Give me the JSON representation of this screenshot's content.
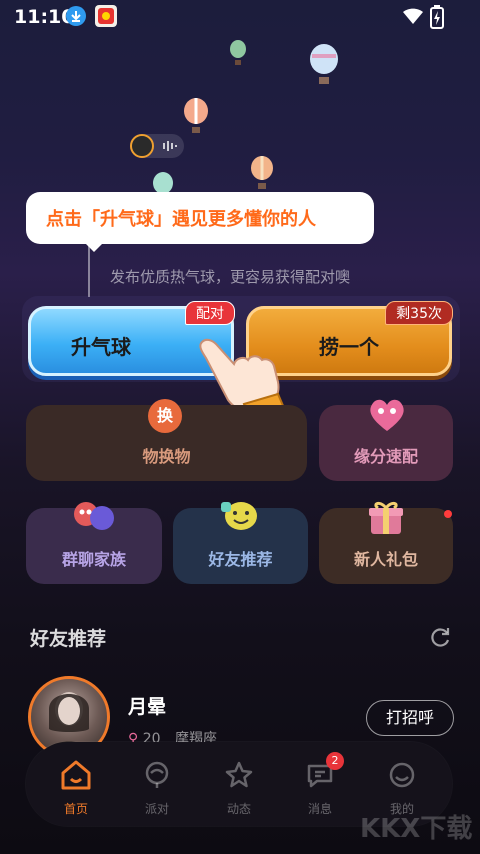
{
  "status_bar": {
    "time": "11:10"
  },
  "tip": {
    "text": "点击「升气球」遇见更多懂你的人"
  },
  "hint": {
    "text": "发布优质热气球，更容易获得配对噢"
  },
  "actions": {
    "raise_balloon": {
      "label": "升气球",
      "badge": "配对"
    },
    "fish_one": {
      "label": "捞一个",
      "badge": "剩35次"
    }
  },
  "features": {
    "exchange": {
      "label": "物换物",
      "icon_text": "换"
    },
    "match": {
      "label": "缘分速配"
    },
    "group": {
      "label": "群聊家族"
    },
    "friend": {
      "label": "好友推荐"
    },
    "gift": {
      "label": "新人礼包"
    }
  },
  "friends_section": {
    "title": "好友推荐"
  },
  "friend": {
    "name": "月晕",
    "age": "20",
    "zodiac": "摩羯座",
    "greet_label": "打招呼"
  },
  "tabs": [
    {
      "label": "首页"
    },
    {
      "label": "派对"
    },
    {
      "label": "动态"
    },
    {
      "label": "消息",
      "badge": "2"
    },
    {
      "label": "我的"
    }
  ],
  "watermark": "KKX下载",
  "colors": {
    "accent": "#f07a2a",
    "tip_text": "#ff6a1a",
    "badge_red": "#e8343a"
  }
}
